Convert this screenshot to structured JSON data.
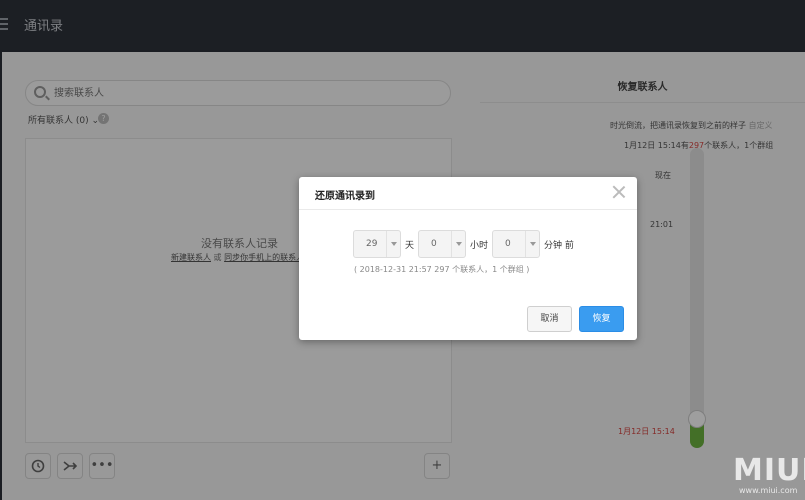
{
  "header": {
    "title": "通讯录",
    "menu_icon": "hamburger-icon"
  },
  "main": {
    "search_placeholder": "搜索联系人",
    "filter_label": "所有联系人 (0)",
    "help_icon": "?",
    "empty_title": "没有联系人记录",
    "empty_link_new": "新建联系人",
    "empty_link_or": "或",
    "empty_link_sync": "同步你手机上的联系人",
    "toolbar": {
      "history_icon": "history-icon",
      "merge_icon": "merge-icon",
      "more_label": "•••",
      "add_label": "+"
    }
  },
  "restore_panel": {
    "title": "恢复联系人",
    "desc": "时光倒流，把通讯录恢复到之前的样子",
    "desc_link": "自定义",
    "info_prefix": "1月12日 15:14有",
    "info_count": "297",
    "info_suffix": "个联系人，1个群组",
    "label_now": "现在",
    "label_time": "21:01",
    "label_date": "1月12日 15:14"
  },
  "dialog": {
    "title": "还原通讯录到",
    "days_value": "29",
    "days_unit": "天",
    "hours_value": "0",
    "hours_unit": "小时",
    "minutes_value": "0",
    "minutes_unit": "分钟 前",
    "note": "( 2018-12-31 21:57 297 个联系人，1 个群组 )",
    "cancel_label": "取消",
    "restore_label": "恢复"
  },
  "watermark": {
    "logo": "MIUI",
    "url": "www.miui.com"
  }
}
